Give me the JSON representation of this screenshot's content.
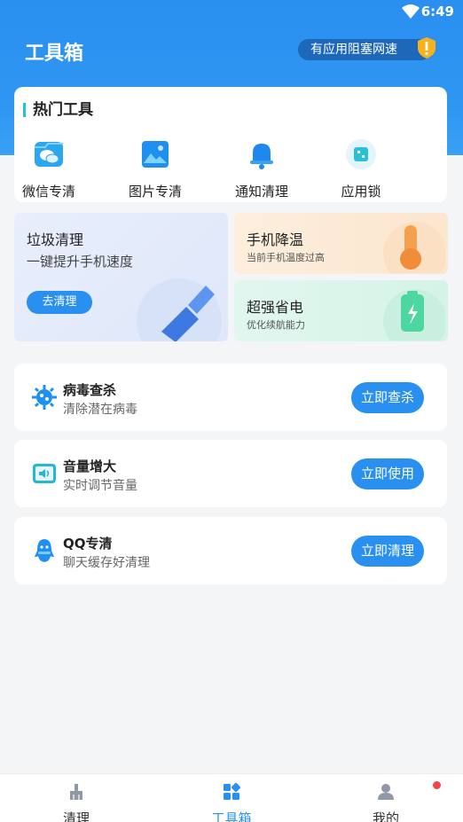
{
  "status_bar": {
    "time": "6:49"
  },
  "header": {
    "title": "工具箱",
    "speed_notice": "有应用阻塞网速"
  },
  "hot_tools": {
    "title": "热门工具",
    "items": [
      {
        "label": "微信专清",
        "icon": "wechat-clean-icon"
      },
      {
        "label": "图片专清",
        "icon": "image-clean-icon"
      },
      {
        "label": "通知清理",
        "icon": "bell-icon"
      },
      {
        "label": "应用锁",
        "icon": "app-lock-icon"
      }
    ]
  },
  "promo": {
    "junk": {
      "title": "垃圾清理",
      "subtitle": "一键提升手机速度",
      "button": "去清理"
    },
    "cool": {
      "title": "手机降温",
      "subtitle": "当前手机温度过高"
    },
    "power": {
      "title": "超强省电",
      "subtitle": "优化续航能力"
    }
  },
  "features": [
    {
      "title": "病毒查杀",
      "subtitle": "清除潜在病毒",
      "action": "立即查杀",
      "icon": "virus-icon"
    },
    {
      "title": "音量增大",
      "subtitle": "实时调节音量",
      "action": "立即使用",
      "icon": "volume-icon"
    },
    {
      "title": "QQ专清",
      "subtitle": "聊天缓存好清理",
      "action": "立即清理",
      "icon": "qq-icon"
    }
  ],
  "tabs": [
    {
      "label": "清理",
      "icon": "broom-icon"
    },
    {
      "label": "工具箱",
      "icon": "toolbox-icon",
      "active": true
    },
    {
      "label": "我的",
      "icon": "profile-icon"
    }
  ],
  "colors": {
    "accent": "#2a90f0",
    "header": "#2f97f2",
    "badge": "#f04848"
  }
}
